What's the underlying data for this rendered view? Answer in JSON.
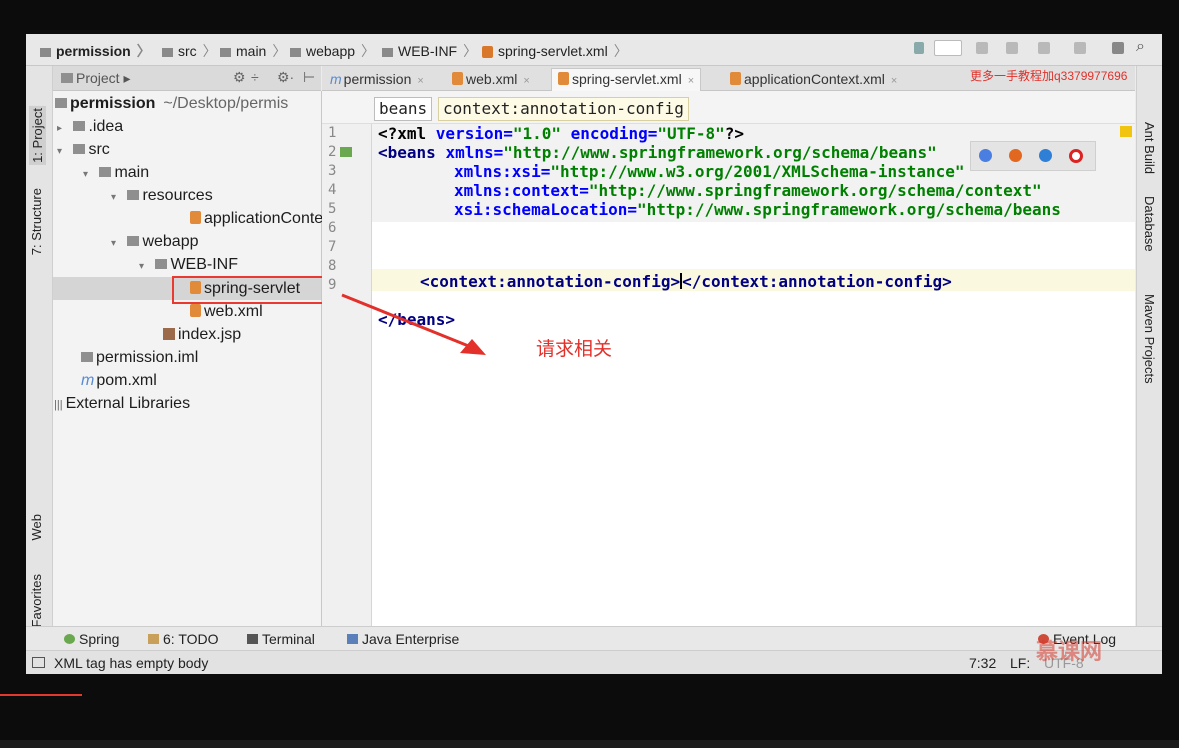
{
  "navbar": {
    "crumbs": [
      "permission",
      "src",
      "main",
      "webapp",
      "WEB-INF",
      "spring-servlet.xml"
    ]
  },
  "left_stripe": {
    "tabs": [
      "1: Project",
      "7: Structure",
      "Web",
      "Favorites"
    ]
  },
  "project_panel": {
    "header_label": "Project",
    "tree": {
      "root_name": "permission",
      "root_path": "~/Desktop/permis",
      "idea": ".idea",
      "src": "src",
      "main": "main",
      "resources": "resources",
      "application_context": "applicationConte",
      "webapp": "webapp",
      "web_inf": "WEB-INF",
      "spring_servlet": "spring-servlet",
      "web_xml": "web.xml",
      "index_jsp": "index.jsp",
      "permission_iml": "permission.iml",
      "pom_xml": "pom.xml",
      "external_libraries": "External Libraries"
    }
  },
  "editor_tabs": [
    {
      "label": "permission"
    },
    {
      "label": "web.xml"
    },
    {
      "label": "spring-servlet.xml"
    },
    {
      "label": "applicationContext.xml"
    }
  ],
  "watermark": "更多一手教程加q3379977696",
  "breadcrumb": {
    "first": "beans",
    "second": "context:annotation-config"
  },
  "code": {
    "line_numbers": [
      "1",
      "2",
      "3",
      "4",
      "5",
      "6",
      "7",
      "8",
      "9"
    ],
    "l1": {
      "a": "<?xml ",
      "b": "version=",
      "c": "\"1.0\"",
      "d": " encoding=",
      "e": "\"UTF-8\"",
      "f": "?>"
    },
    "l2": {
      "a": "<beans ",
      "b": "xmlns=",
      "c": "\"http://www.springframework.org/schema/beans\""
    },
    "l3": {
      "b": "xmlns:xsi=",
      "c": "\"http://www.w3.org/2001/XMLSchema-instance\""
    },
    "l4": {
      "b": "xmlns:context=",
      "c": "\"http://www.springframework.org/schema/context\""
    },
    "l5": {
      "b": "xsi:schemaLocation=",
      "c": "\"http://www.springframework.org/schema/beans"
    },
    "l7": {
      "a": "<context:annotation-config>",
      "b": "</context:annotation-config>"
    },
    "l9": {
      "a": "</beans>"
    }
  },
  "annotation_text": "请求相关",
  "right_stripe": {
    "tabs": [
      "Ant Build",
      "Database",
      "Maven Projects"
    ]
  },
  "tool_windows": [
    "Spring",
    "6: TODO",
    "Terminal",
    "Java Enterprise",
    "Event Log"
  ],
  "status": {
    "message": "XML tag has empty body",
    "position": "7:32",
    "line_sep": "LF:",
    "encoding": "UTF-8"
  },
  "mooc_logo": "慕课网",
  "colors": {
    "annotation_red": "#e3302a",
    "tag_blue": "#000080",
    "attr_blue": "#0000ff",
    "value_green": "#008000"
  }
}
